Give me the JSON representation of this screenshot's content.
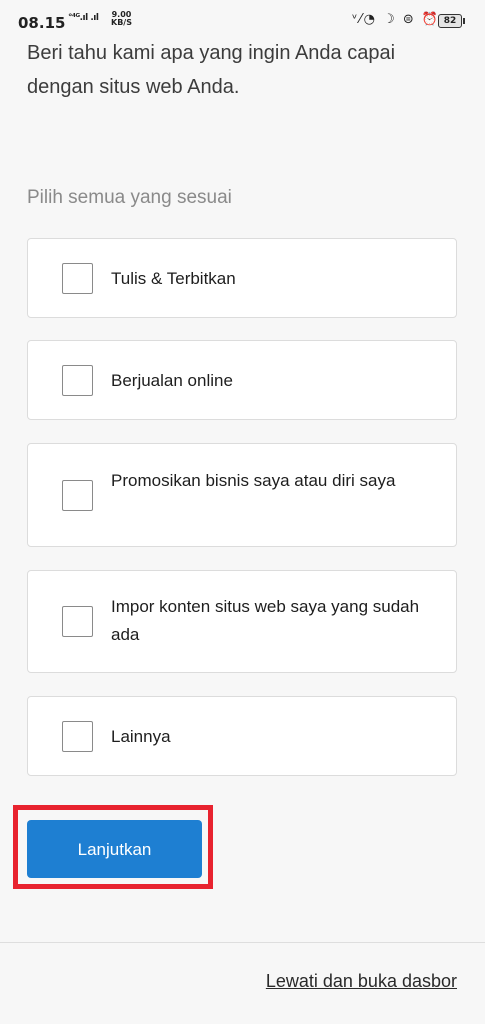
{
  "status_bar": {
    "time": "08.15",
    "network": "°⁴ᴳ.ıl .ıl",
    "speed_value": "9.00",
    "speed_unit": "KB/S",
    "icons": "ᵛ⁄◔ ☽ ⊜ ⏰",
    "battery": "82"
  },
  "intro": {
    "text": "Beri tahu kami apa yang ingin Anda capai dengan situs web Anda."
  },
  "options_section": {
    "label": "Pilih semua yang sesuai",
    "items": [
      {
        "label": "Tulis & Terbitkan",
        "checked": false
      },
      {
        "label": "Berjualan online",
        "checked": false
      },
      {
        "label": "Promosikan bisnis saya atau diri saya",
        "checked": false
      },
      {
        "label": "Impor konten situs web saya yang sudah ada",
        "checked": false
      },
      {
        "label": "Lainnya",
        "checked": false
      }
    ]
  },
  "actions": {
    "continue_label": "Lanjutkan",
    "skip_label": "Lewati dan buka dasbor"
  },
  "colors": {
    "primary": "#1e7fd2",
    "highlight": "#e8232f"
  }
}
